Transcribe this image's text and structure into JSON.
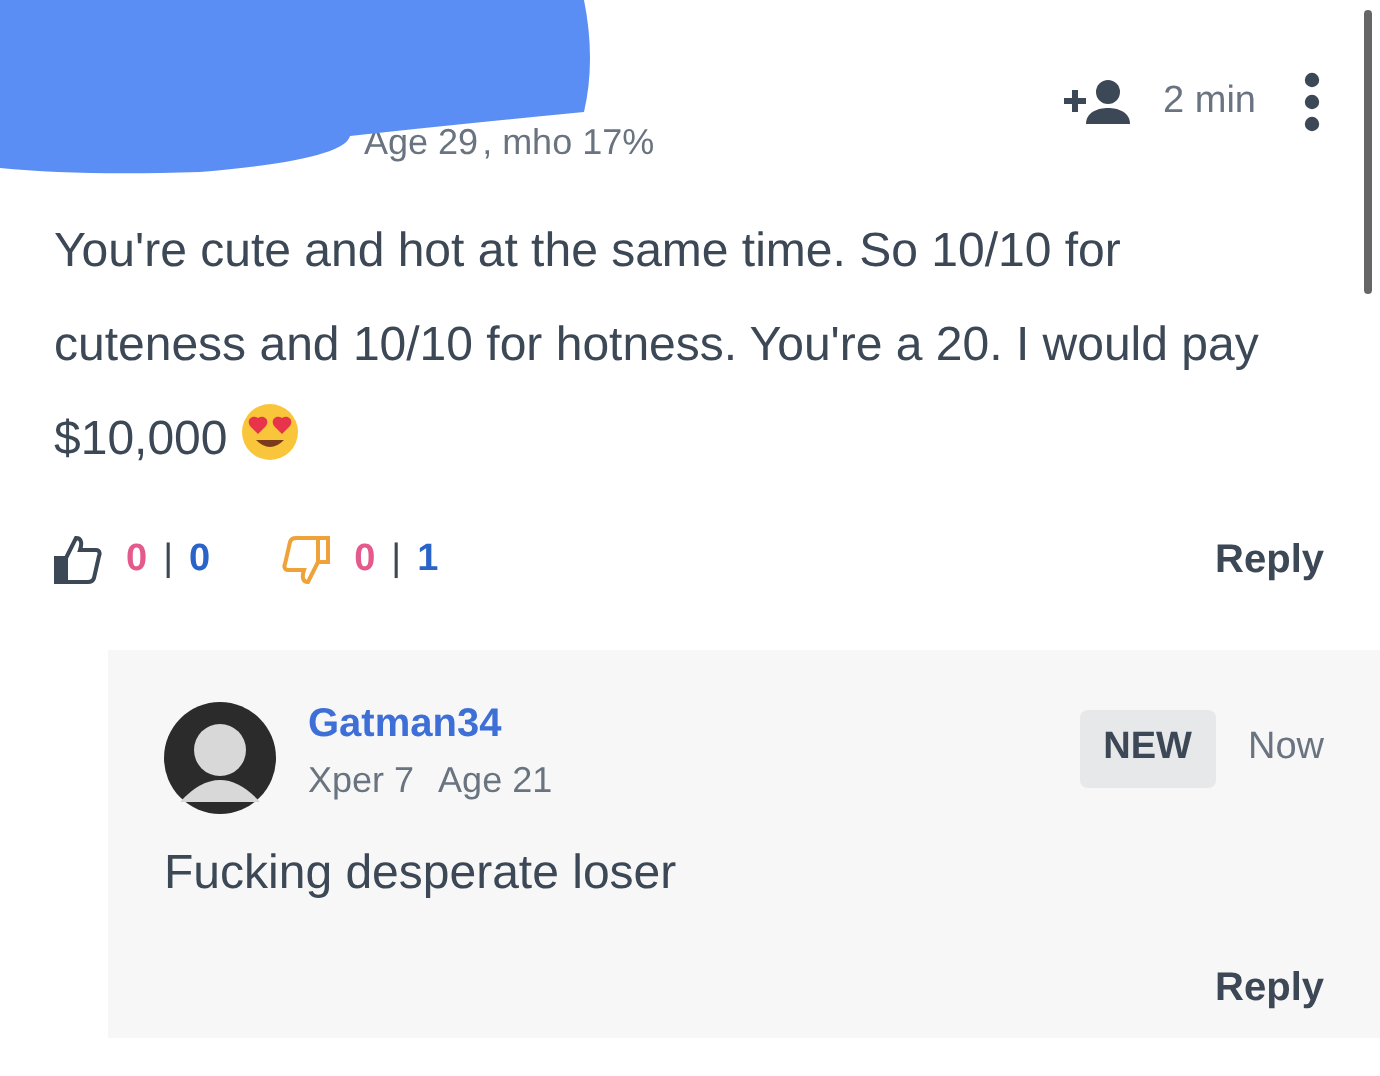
{
  "comment": {
    "age": "Age 29",
    "mho": ", mho 17%",
    "redacted": true,
    "time": "2 min",
    "text": "You're cute and hot at the same time. So 10/10 for cuteness and 10/10 for hotness. You're a 20. I would pay $10,000",
    "likes": {
      "female": "0",
      "separator": "|",
      "male": "0"
    },
    "dislikes": {
      "female": "0",
      "separator": "|",
      "male": "1"
    },
    "reply": "Reply"
  },
  "replies": [
    {
      "author": "Gatman34",
      "meta": "Xper 7",
      "age": "Age 21",
      "badge": "NEW",
      "time": "Now",
      "text": "Fucking desperate loser",
      "reply": "Reply"
    }
  ]
}
